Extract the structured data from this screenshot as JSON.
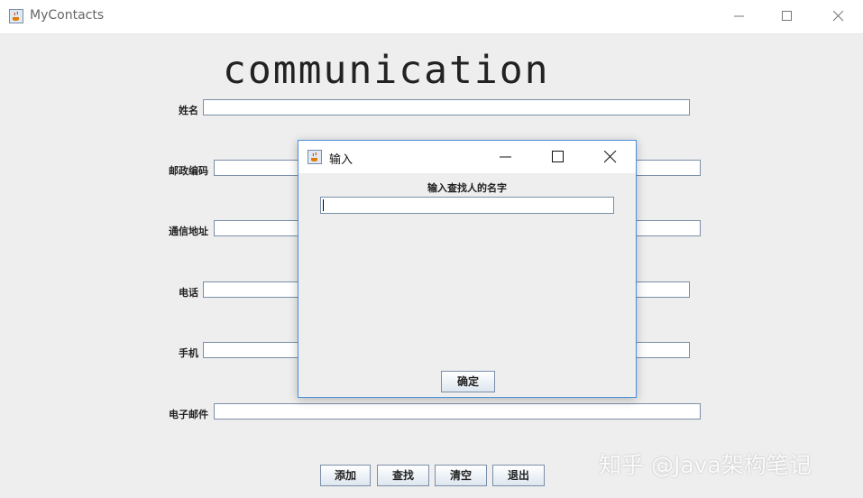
{
  "window": {
    "title": "MyContacts",
    "icon": "java-cup-icon"
  },
  "heading": "communication",
  "form": {
    "name_label": "姓名",
    "postcode_label": "邮政编码",
    "address_label": "通信地址",
    "phone_label": "电话",
    "mobile_label": "手机",
    "email_label": "电子邮件",
    "name_value": "",
    "postcode_value": "",
    "address_value": "",
    "phone_value": "",
    "mobile_value": "",
    "email_value": ""
  },
  "buttons": {
    "add": "添加",
    "search": "查找",
    "clear": "清空",
    "exit": "退出"
  },
  "dialog": {
    "title": "输入",
    "prompt": "输入查找人的名字",
    "input_value": "",
    "ok": "确定"
  },
  "watermark": "知乎 @Java架构笔记",
  "colors": {
    "background": "#eeeeee",
    "field_border": "#7a8ea8",
    "dialog_border": "#4a90d9"
  }
}
